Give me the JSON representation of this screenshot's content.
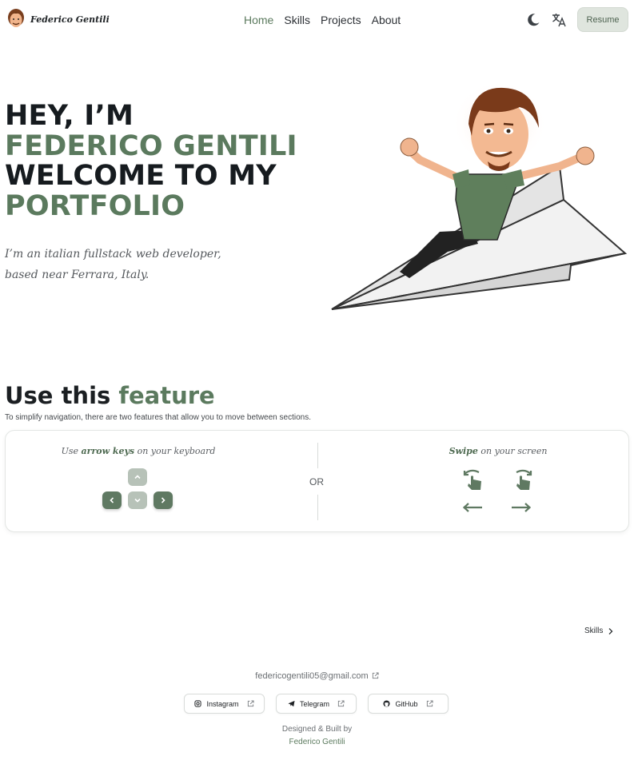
{
  "nav": {
    "brand_name": "Federico Gentili",
    "links": [
      "Home",
      "Skills",
      "Projects",
      "About"
    ],
    "active_link": "Home",
    "resume_label": "Resume",
    "icons": [
      "moon-icon",
      "translate-icon"
    ]
  },
  "hero": {
    "line1": "HEY, I’M",
    "line2": "FEDERICO GENTILI",
    "line3": "WELCOME TO MY",
    "line4": "PORTFOLIO",
    "description": "I’m an italian fullstack web developer, based near Ferrara, Italy."
  },
  "feature": {
    "heading_plain": "Use this ",
    "heading_accent": "feature",
    "subtitle": "To simplify navigation, there are two features that allow you to move between sections.",
    "keyboard_pre": "Use ",
    "keyboard_bold": "arrow keys",
    "keyboard_post": " on your keyboard",
    "or_label": "OR",
    "swipe_bold": "Swipe",
    "swipe_post": " on your screen"
  },
  "section_nav": {
    "next_label": "Skills"
  },
  "footer": {
    "email": "federicogentili05@gmail.com",
    "socials": [
      "Instagram",
      "Telegram",
      "GitHub"
    ],
    "credit_line1": "Designed & Built by",
    "credit_line2": "Federico Gentili"
  },
  "colors": {
    "accent": "#5b7a5e",
    "accent_soft": "#b7c2b8",
    "resume_bg": "#dfe5de",
    "text_dark": "#161b1f"
  }
}
